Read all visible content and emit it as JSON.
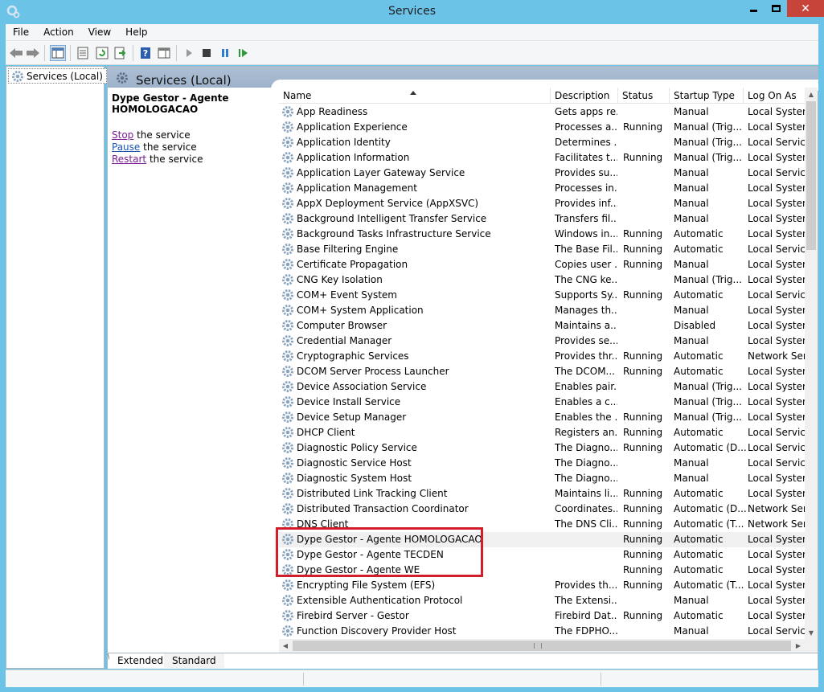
{
  "window": {
    "title": "Services"
  },
  "menu": [
    "File",
    "Action",
    "View",
    "Help"
  ],
  "toolbar": {
    "buttons": [
      "back-icon",
      "forward-icon",
      "show-hide-console-tree-icon",
      "properties-icon",
      "refresh-icon",
      "export-list-icon",
      "help-icon",
      "show-action-pane-icon",
      "start-service-icon",
      "stop-service-icon",
      "pause-service-icon",
      "restart-service-icon"
    ]
  },
  "tree": {
    "root_label": "Services (Local)"
  },
  "content": {
    "header_title": "Services (Local)",
    "selected_service": {
      "title": "Dype Gestor - Agente HOMOLOGACAO",
      "actions": [
        {
          "link": "Stop",
          "rest": " the service"
        },
        {
          "link": "Pause",
          "rest": " the service"
        },
        {
          "link": "Restart",
          "rest": " the service"
        }
      ]
    }
  },
  "columns": {
    "name": "Name",
    "description": "Description",
    "status": "Status",
    "startup": "Startup Type",
    "logon": "Log On As"
  },
  "services": [
    {
      "name": "App Readiness",
      "desc": "Gets apps re...",
      "status": "",
      "startup": "Manual",
      "logon": "Local System"
    },
    {
      "name": "Application Experience",
      "desc": "Processes a...",
      "status": "Running",
      "startup": "Manual (Trig...",
      "logon": "Local System"
    },
    {
      "name": "Application Identity",
      "desc": "Determines ...",
      "status": "",
      "startup": "Manual (Trig...",
      "logon": "Local Service"
    },
    {
      "name": "Application Information",
      "desc": "Facilitates t...",
      "status": "Running",
      "startup": "Manual (Trig...",
      "logon": "Local System"
    },
    {
      "name": "Application Layer Gateway Service",
      "desc": "Provides su...",
      "status": "",
      "startup": "Manual",
      "logon": "Local Service"
    },
    {
      "name": "Application Management",
      "desc": "Processes in...",
      "status": "",
      "startup": "Manual",
      "logon": "Local System"
    },
    {
      "name": "AppX Deployment Service (AppXSVC)",
      "desc": "Provides inf...",
      "status": "",
      "startup": "Manual",
      "logon": "Local System"
    },
    {
      "name": "Background Intelligent Transfer Service",
      "desc": "Transfers fil...",
      "status": "",
      "startup": "Manual",
      "logon": "Local System"
    },
    {
      "name": "Background Tasks Infrastructure Service",
      "desc": "Windows in...",
      "status": "Running",
      "startup": "Automatic",
      "logon": "Local System"
    },
    {
      "name": "Base Filtering Engine",
      "desc": "The Base Fil...",
      "status": "Running",
      "startup": "Automatic",
      "logon": "Local Service"
    },
    {
      "name": "Certificate Propagation",
      "desc": "Copies user ...",
      "status": "Running",
      "startup": "Manual",
      "logon": "Local System"
    },
    {
      "name": "CNG Key Isolation",
      "desc": "The CNG ke...",
      "status": "",
      "startup": "Manual (Trig...",
      "logon": "Local System"
    },
    {
      "name": "COM+ Event System",
      "desc": "Supports Sy...",
      "status": "Running",
      "startup": "Automatic",
      "logon": "Local Service"
    },
    {
      "name": "COM+ System Application",
      "desc": "Manages th...",
      "status": "",
      "startup": "Manual",
      "logon": "Local System"
    },
    {
      "name": "Computer Browser",
      "desc": "Maintains a...",
      "status": "",
      "startup": "Disabled",
      "logon": "Local System"
    },
    {
      "name": "Credential Manager",
      "desc": "Provides se...",
      "status": "",
      "startup": "Manual",
      "logon": "Local System"
    },
    {
      "name": "Cryptographic Services",
      "desc": "Provides thr...",
      "status": "Running",
      "startup": "Automatic",
      "logon": "Network Servi"
    },
    {
      "name": "DCOM Server Process Launcher",
      "desc": "The DCOM...",
      "status": "Running",
      "startup": "Automatic",
      "logon": "Local System"
    },
    {
      "name": "Device Association Service",
      "desc": "Enables pair...",
      "status": "",
      "startup": "Manual (Trig...",
      "logon": "Local System"
    },
    {
      "name": "Device Install Service",
      "desc": "Enables a c...",
      "status": "",
      "startup": "Manual (Trig...",
      "logon": "Local System"
    },
    {
      "name": "Device Setup Manager",
      "desc": "Enables the ...",
      "status": "Running",
      "startup": "Manual (Trig...",
      "logon": "Local System"
    },
    {
      "name": "DHCP Client",
      "desc": "Registers an...",
      "status": "Running",
      "startup": "Automatic",
      "logon": "Local Service"
    },
    {
      "name": "Diagnostic Policy Service",
      "desc": "The Diagno...",
      "status": "Running",
      "startup": "Automatic (D...",
      "logon": "Local Service"
    },
    {
      "name": "Diagnostic Service Host",
      "desc": "The Diagno...",
      "status": "",
      "startup": "Manual",
      "logon": "Local Service"
    },
    {
      "name": "Diagnostic System Host",
      "desc": "The Diagno...",
      "status": "",
      "startup": "Manual",
      "logon": "Local System"
    },
    {
      "name": "Distributed Link Tracking Client",
      "desc": "Maintains li...",
      "status": "Running",
      "startup": "Automatic",
      "logon": "Local System"
    },
    {
      "name": "Distributed Transaction Coordinator",
      "desc": "Coordinates...",
      "status": "Running",
      "startup": "Automatic (D...",
      "logon": "Network Servi"
    },
    {
      "name": "DNS Client",
      "desc": "The DNS Cli...",
      "status": "Running",
      "startup": "Automatic (T...",
      "logon": "Network Servi"
    },
    {
      "name": "Dype Gestor - Agente HOMOLOGACAO",
      "desc": "",
      "status": "Running",
      "startup": "Automatic",
      "logon": "Local System",
      "selected": true
    },
    {
      "name": "Dype Gestor - Agente TECDEN",
      "desc": "",
      "status": "Running",
      "startup": "Automatic",
      "logon": "Local System"
    },
    {
      "name": "Dype Gestor - Agente WE",
      "desc": "",
      "status": "Running",
      "startup": "Automatic",
      "logon": "Local System"
    },
    {
      "name": "Encrypting File System (EFS)",
      "desc": "Provides th...",
      "status": "Running",
      "startup": "Automatic (T...",
      "logon": "Local System"
    },
    {
      "name": "Extensible Authentication Protocol",
      "desc": "The Extensi...",
      "status": "",
      "startup": "Manual",
      "logon": "Local System"
    },
    {
      "name": "Firebird Server - Gestor",
      "desc": "Firebird Dat...",
      "status": "Running",
      "startup": "Automatic",
      "logon": "Local System"
    },
    {
      "name": "Function Discovery Provider Host",
      "desc": "The FDPHO...",
      "status": "",
      "startup": "Manual",
      "logon": "Local Service"
    }
  ],
  "tabs": [
    "Extended",
    "Standard"
  ],
  "colors": {
    "title_bar": "#6cc3e8",
    "close_button": "#c7443a",
    "highlight_box": "#d21e2a",
    "link_visited": "#7a1d94",
    "link": "#1a55b3"
  }
}
